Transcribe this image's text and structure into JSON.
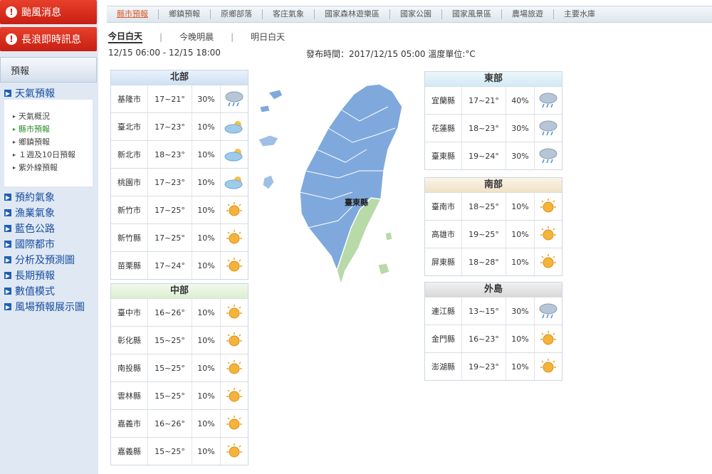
{
  "sidebar": {
    "alerts": [
      "颱風消息",
      "長浪即時訊息"
    ],
    "forecast_heading": "預報",
    "weather_forecast": "天氣預報",
    "sub_items": [
      "天氣概況",
      "縣市預報",
      "鄉鎮預報",
      "１週及10日預報",
      "紫外線預報"
    ],
    "active_sub": 1,
    "main_items": [
      "預約氣象",
      "漁業氣象",
      "藍色公路",
      "國際都市",
      "分析及預測圖",
      "長期預報",
      "數值模式",
      "風場預報展示圖"
    ]
  },
  "topnav": {
    "items": [
      "縣市預報",
      "鄉鎮預報",
      "原鄉部落",
      "客庄氣象",
      "國家森林遊樂區",
      "國家公園",
      "國家風景區",
      "農場旅遊",
      "主要水庫"
    ],
    "active": 0
  },
  "time_tabs": {
    "items": [
      "今日白天",
      "今晚明晨",
      "明日白天"
    ],
    "active": 0
  },
  "time_range": "12/15 06:00 - 12/15 18:00",
  "issued": "發布時間：2017/12/15 05:00 溫度單位:°C",
  "map_label": "臺東縣",
  "regions": {
    "north": {
      "title": "北部",
      "rows": [
        {
          "city": "基隆市",
          "temp": "17~21°",
          "pop": "30%",
          "icon": "rain-cloud-icon"
        },
        {
          "city": "臺北市",
          "temp": "17~23°",
          "pop": "10%",
          "icon": "cloudy-icon"
        },
        {
          "city": "新北市",
          "temp": "18~23°",
          "pop": "10%",
          "icon": "cloudy-icon"
        },
        {
          "city": "桃園市",
          "temp": "17~23°",
          "pop": "10%",
          "icon": "cloudy-icon"
        },
        {
          "city": "新竹市",
          "temp": "17~25°",
          "pop": "10%",
          "icon": "sunny-icon"
        },
        {
          "city": "新竹縣",
          "temp": "17~25°",
          "pop": "10%",
          "icon": "sunny-icon"
        },
        {
          "city": "苗栗縣",
          "temp": "17~24°",
          "pop": "10%",
          "icon": "sunny-icon"
        }
      ]
    },
    "central": {
      "title": "中部",
      "rows": [
        {
          "city": "臺中市",
          "temp": "16~26°",
          "pop": "10%",
          "icon": "sunny-icon"
        },
        {
          "city": "彰化縣",
          "temp": "15~25°",
          "pop": "10%",
          "icon": "sunny-icon"
        },
        {
          "city": "南投縣",
          "temp": "15~25°",
          "pop": "10%",
          "icon": "sunny-icon"
        },
        {
          "city": "雲林縣",
          "temp": "15~25°",
          "pop": "10%",
          "icon": "sunny-icon"
        },
        {
          "city": "嘉義市",
          "temp": "16~26°",
          "pop": "10%",
          "icon": "sunny-icon"
        },
        {
          "city": "嘉義縣",
          "temp": "15~25°",
          "pop": "10%",
          "icon": "sunny-icon"
        }
      ]
    },
    "east": {
      "title": "東部",
      "rows": [
        {
          "city": "宜蘭縣",
          "temp": "17~21°",
          "pop": "40%",
          "icon": "rain-cloud-icon"
        },
        {
          "city": "花蓮縣",
          "temp": "18~23°",
          "pop": "30%",
          "icon": "rain-cloud-icon"
        },
        {
          "city": "臺東縣",
          "temp": "19~24°",
          "pop": "30%",
          "icon": "rain-cloud-icon"
        }
      ]
    },
    "south": {
      "title": "南部",
      "rows": [
        {
          "city": "臺南市",
          "temp": "18~25°",
          "pop": "10%",
          "icon": "sunny-icon"
        },
        {
          "city": "高雄市",
          "temp": "19~25°",
          "pop": "10%",
          "icon": "sunny-icon"
        },
        {
          "city": "屏東縣",
          "temp": "18~28°",
          "pop": "10%",
          "icon": "sunny-icon"
        }
      ]
    },
    "islands": {
      "title": "外島",
      "rows": [
        {
          "city": "連江縣",
          "temp": "13~15°",
          "pop": "30%",
          "icon": "rain-cloud-icon"
        },
        {
          "city": "金門縣",
          "temp": "16~23°",
          "pop": "10%",
          "icon": "sunny-icon"
        },
        {
          "city": "澎湖縣",
          "temp": "19~23°",
          "pop": "10%",
          "icon": "sunny-icon"
        }
      ]
    }
  },
  "colors": {
    "alert_red": "#d22b1a",
    "link_blue": "#1a4fa0",
    "map_blue": "#7fa9dc",
    "map_green": "#b8d9a8"
  }
}
